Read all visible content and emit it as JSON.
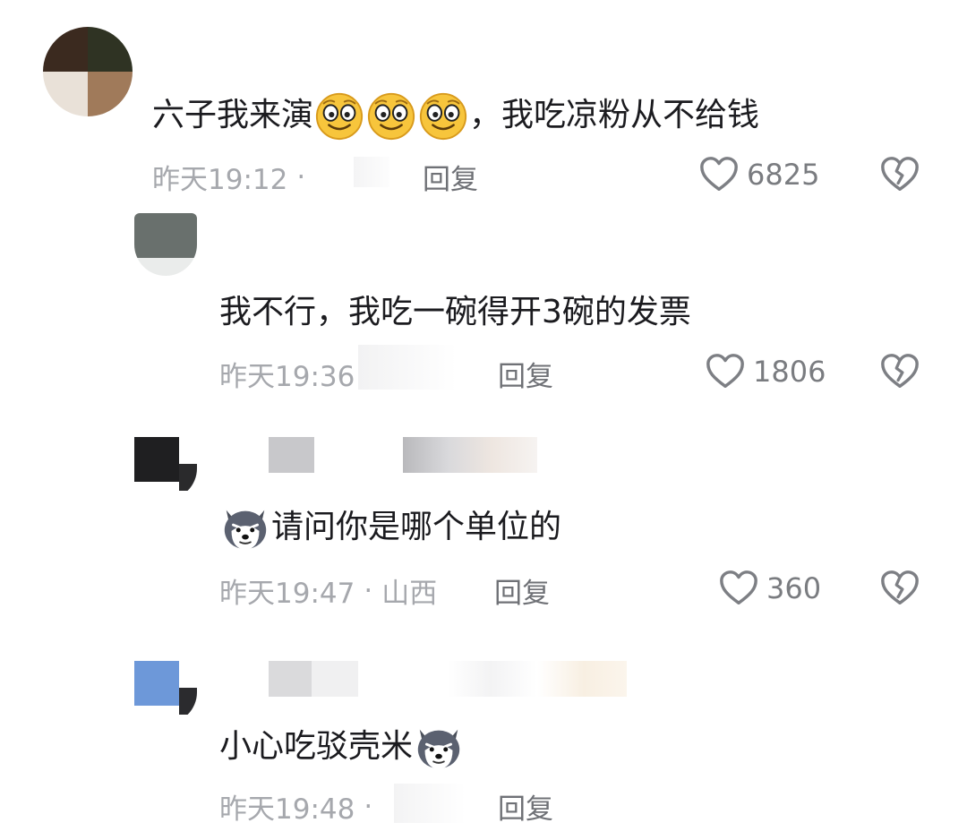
{
  "comments": [
    {
      "text_before": "六子我来演",
      "emojis": [
        "smile-emoji",
        "smile-emoji",
        "smile-emoji"
      ],
      "text_after": "，我吃凉粉从不给钱",
      "time": "昨天19:12",
      "location": "",
      "reply_label": "回复",
      "likes": "6825"
    },
    {
      "text_before": "我不行，我吃一碗得开3碗的发票",
      "time": "昨天19:36",
      "location": "",
      "reply_label": "回复",
      "likes": "1806"
    },
    {
      "emoji_leading": "husky-emoji",
      "text_before": "请问你是哪个单位的",
      "time": "昨天19:47",
      "location": "山西",
      "reply_label": "回复",
      "likes": "360"
    },
    {
      "text_before": "小心吃驳壳米",
      "emoji_trailing": "husky-emoji",
      "time": "昨天19:48",
      "location": "",
      "reply_label": "回复"
    }
  ],
  "separator": "·",
  "colors": {
    "meta": "#a6a8ad",
    "text": "#1b1b1f",
    "icon": "#8a8c90"
  }
}
